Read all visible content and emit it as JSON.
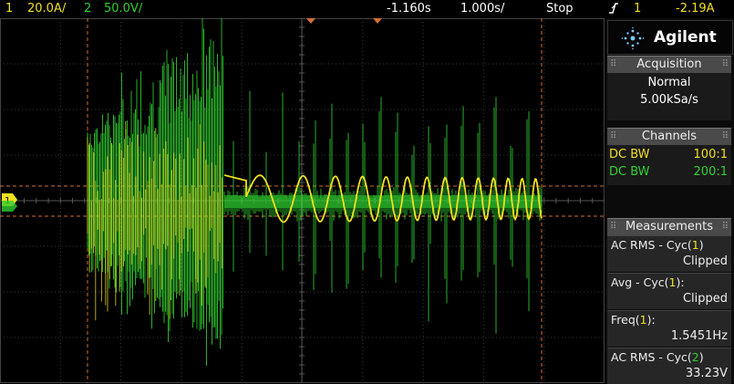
{
  "status_bar": {
    "ch1_number": "1",
    "ch1_scale": "20.0A/",
    "ch2_number": "2",
    "ch2_scale": "50.0V/",
    "time_offset": "-1.160s",
    "time_scale": "1.000s/",
    "run_state": "Stop",
    "trigger_icon": "trigger-edge-icon",
    "trigger_source": "1",
    "trigger_level": "-2.19A"
  },
  "brand": {
    "name": "Agilent",
    "logo_icon": "spark-logo-icon"
  },
  "acquisition": {
    "header": "Acquisition",
    "mode": "Normal",
    "sample_rate": "5.00kSa/s"
  },
  "channels": {
    "header": "Channels",
    "rows": [
      {
        "coupling": "DC BW",
        "probe": "100:1",
        "color": "#f0e020"
      },
      {
        "coupling": "DC BW",
        "probe": "200:1",
        "color": "#30d030"
      }
    ]
  },
  "measurements": {
    "header": "Measurements",
    "items": [
      {
        "label_prefix": "AC RMS - Cyc(",
        "channel": "1",
        "label_suffix": ")",
        "value": "Clipped"
      },
      {
        "label_prefix": "Avg - Cyc(",
        "channel": "1",
        "label_suffix": "):",
        "value": "Clipped"
      },
      {
        "label_prefix": "Freq(",
        "channel": "1",
        "label_suffix": "):",
        "value": "1.5451Hz"
      },
      {
        "label_prefix": "AC RMS - Cyc(",
        "channel": "2",
        "label_suffix": ")",
        "value": "33.23V"
      }
    ]
  },
  "channel_colors": {
    "ch1": "#f0e020",
    "ch2": "#30d030",
    "cursor": "#d07030",
    "grid": "#3a3a3a"
  },
  "ground_marker": "1"
}
